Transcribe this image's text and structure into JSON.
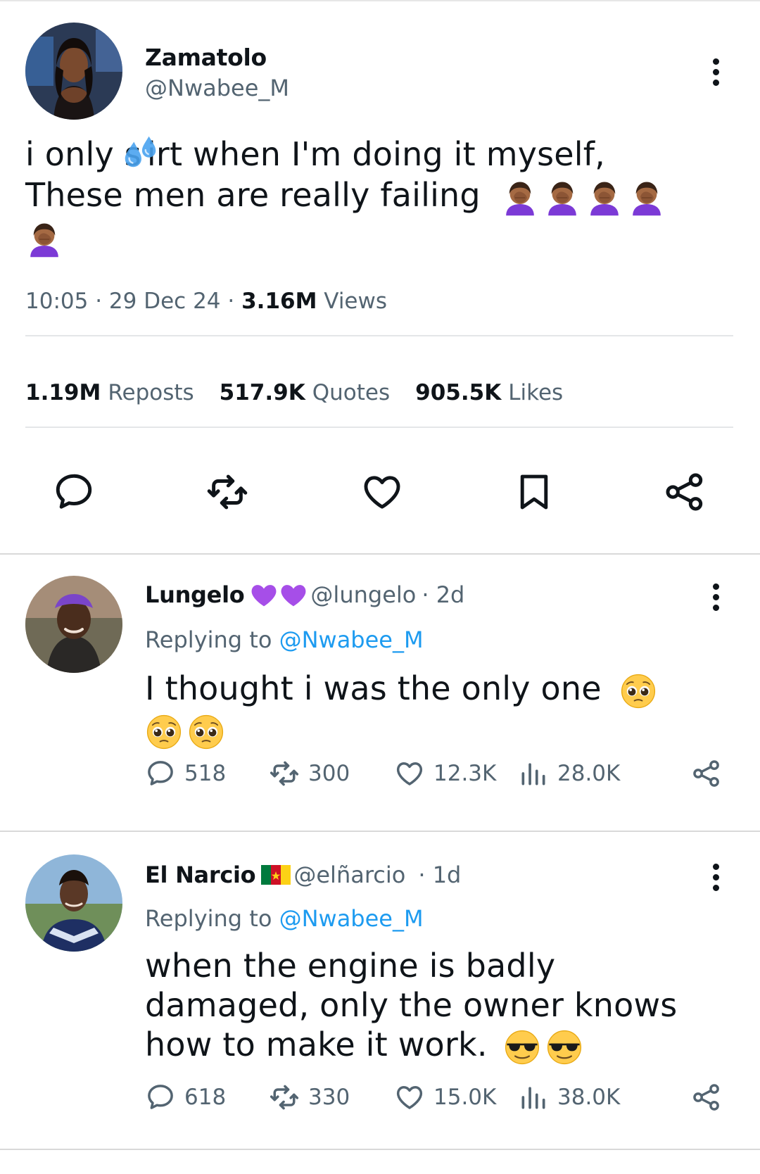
{
  "tweet": {
    "author_name": "Zamatolo",
    "author_handle": "@Nwabee_M",
    "text_line1_a": "i only s",
    "text_line1_b": "irt when I'm doing it myself,",
    "text_line2": "These men are really failing",
    "emoji_inline": "sweat-droplets-icon",
    "emoji_trailing": "face-palm-woman-icon",
    "time": "10:05",
    "date": "29 Dec 24",
    "views_count": "3.16M",
    "views_label": "Views",
    "reposts_count": "1.19M",
    "reposts_label": "Reposts",
    "quotes_count": "517.9K",
    "quotes_label": "Quotes",
    "likes_count": "905.5K",
    "likes_label": "Likes"
  },
  "replies": [
    {
      "name": "Lungelo",
      "handle": "@lungelo",
      "age": "· 2d",
      "badge": "purple-hearts-icon",
      "replying_prefix": "Replying to",
      "replying_to": "@Nwabee_M",
      "text": "I thought i was the only one",
      "emoji": "pleading-face-icon",
      "comments": "518",
      "reposts": "300",
      "likes": "12.3K",
      "views": "28.0K"
    },
    {
      "name": "El Narcio",
      "handle": "@elñarcio",
      "age": "· 1d",
      "badge": "cameroon-flag-icon",
      "replying_prefix": "Replying to",
      "replying_to": "@Nwabee_M",
      "text_line1": "when the engine is badly",
      "text_line2": "damaged, only the owner knows",
      "text_line3": "how to make it work.",
      "emoji": "sunglasses-face-icon",
      "comments": "618",
      "reposts": "330",
      "likes": "15.0K",
      "views": "38.0K"
    }
  ],
  "colors": {
    "text": "#0f1419",
    "secondary": "#536471",
    "link": "#1d9bf0",
    "divider": "#e4e6e8"
  }
}
